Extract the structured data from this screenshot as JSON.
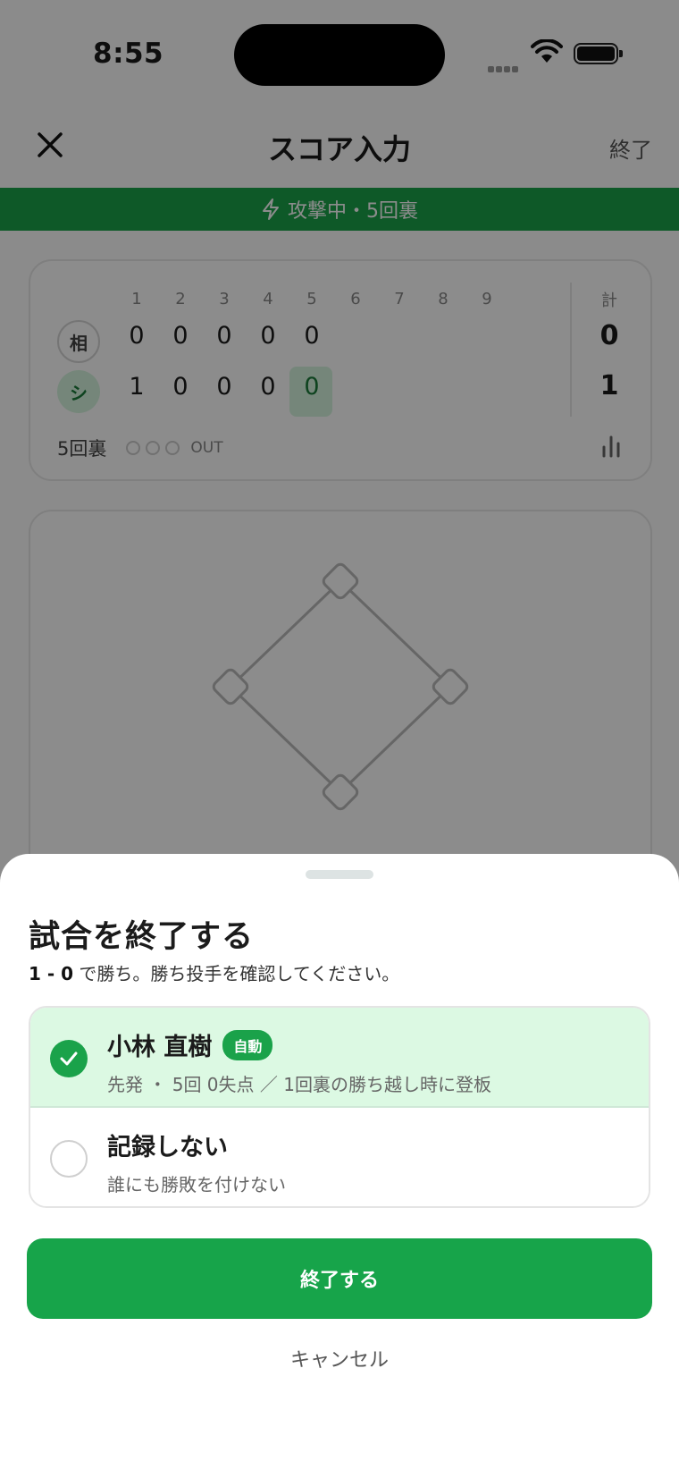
{
  "status_bar": {
    "time": "8:55"
  },
  "nav": {
    "title": "スコア入力",
    "finish_label": "終了"
  },
  "banner": {
    "text": "攻撃中・5回裏"
  },
  "scoreboard": {
    "innings": [
      "1",
      "2",
      "3",
      "4",
      "5",
      "6",
      "7",
      "8",
      "9"
    ],
    "total_header": "計",
    "teams": [
      {
        "badge": "相",
        "scores": [
          "0",
          "0",
          "0",
          "0",
          "0"
        ],
        "total": "0"
      },
      {
        "badge": "シ",
        "scores": [
          "1",
          "0",
          "0",
          "0",
          "0"
        ],
        "total": "1"
      }
    ],
    "current_inning": "5回裏",
    "out_label": "OUT"
  },
  "sheet": {
    "title": "試合を終了する",
    "score": "1 - 0",
    "subtitle_rest": " で勝ち。勝ち投手を確認してください。",
    "options": [
      {
        "name": "小林 直樹",
        "badge": "自動",
        "description": "先発 ・ 5回 0失点 ／ 1回裏の勝ち越し時に登板",
        "selected": true
      },
      {
        "name": "記録しない",
        "description": "誰にも勝敗を付けない",
        "selected": false
      }
    ],
    "confirm_label": "終了する",
    "cancel_label": "キャンセル"
  },
  "colors": {
    "accent": "#17a44a",
    "selected_bg": "#dcf9e3"
  }
}
